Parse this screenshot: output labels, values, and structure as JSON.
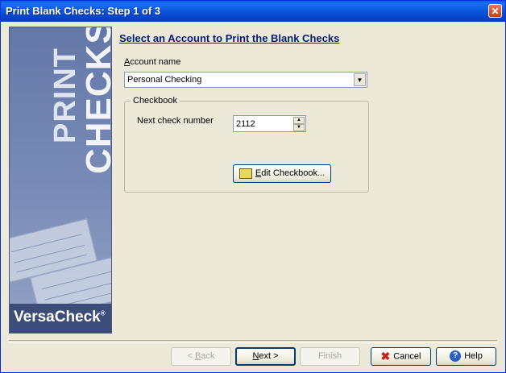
{
  "window": {
    "title": "Print Blank Checks: Step 1 of 3",
    "close_label": "✕"
  },
  "sidebar": {
    "line1": "PRINT",
    "line2": "CHECKS",
    "brand": "VersaCheck",
    "brand_mark": "®"
  },
  "main": {
    "heading": "Select an Account to Print the Blank Checks",
    "account_label_first": "A",
    "account_label_rest": "ccount name",
    "account_value": "Personal Checking",
    "group_title": "Checkbook",
    "next_check_label": "Next check number",
    "next_check_value": "2112",
    "edit_button_first": "E",
    "edit_button_rest": "dit Checkbook..."
  },
  "footer": {
    "back_prefix": "< ",
    "back_underlined": "B",
    "back_rest": "ack",
    "next_underlined": "N",
    "next_rest": "ext >",
    "finish_label": "Finish",
    "cancel_label": "Cancel",
    "help_label": "Help"
  },
  "colors": {
    "titlebar": "#0a55d8",
    "accent_heading": "#0a1a7a",
    "cancel_icon": "#c8201a"
  },
  "icons": [
    "close-icon",
    "dropdown-arrow-icon",
    "spin-up-icon",
    "spin-down-icon",
    "edit-pencil-icon",
    "cancel-x-icon",
    "help-icon"
  ]
}
